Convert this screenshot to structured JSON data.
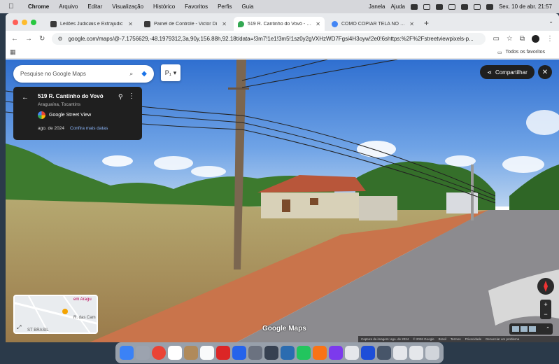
{
  "menubar": {
    "app": "Chrome",
    "items": [
      "Arquivo",
      "Editar",
      "Visualização",
      "Histórico",
      "Favoritos",
      "Perfis",
      "Guia"
    ],
    "window_item": "Janela",
    "help_item": "Ajuda",
    "clock": "Sex. 10 de abr.  21:57"
  },
  "tabs": [
    {
      "title": "Leilões Judiciais e Extrajudic",
      "color": "#3a3a3a",
      "active": false
    },
    {
      "title": "Painel de Controle - Victor Di",
      "color": "#3a3a3a",
      "active": false
    },
    {
      "title": "519 R. Cantinho do Vovó - Go",
      "color": "#34a853",
      "active": true
    },
    {
      "title": "COMO COPIAR TELA NO MAC",
      "color": "#4285f4",
      "active": false
    }
  ],
  "address_bar": {
    "url": "google.com/maps/@-7.1756629,-48.1979312,3a,90y,156.88h,92.18t/data=!3m7!1e1!3m5!1sz0y2gVXHzWD7Fgsi4H3oyw!2e0!6shttps:%2F%2Fstreetviewpixels-p..."
  },
  "bookmarks": {
    "all_label": "Todos os favoritos"
  },
  "maps": {
    "search_placeholder": "Pesquise no Google Maps",
    "share_label": "Compartilhar",
    "address": "519 R. Cantinho do Vovó",
    "locality": "Araguaína, Tocantins",
    "source": "Google Street View",
    "date": "ago. de 2024",
    "more_dates": "Confira mais datas",
    "logo": "Google Maps",
    "minimap_labels": [
      "em Aragu",
      "R. das Cam",
      "ST BRASIL"
    ],
    "footer": [
      "Captura da imagem: ago. de 2024",
      "© 2026 Google",
      "Brasil",
      "Termos",
      "Privacidade",
      "Denunciar um problema"
    ]
  }
}
